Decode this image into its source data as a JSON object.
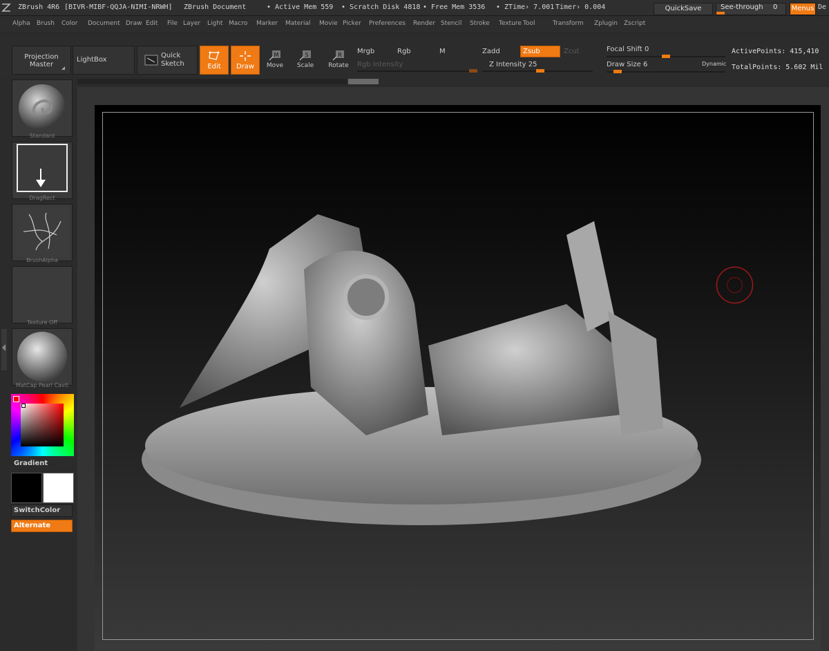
{
  "titlebar": {
    "app": "ZBrush 4R6",
    "serial": "[BIVR-MIBF-QQJA-NIMI-NRWH]",
    "document": "ZBrush Document",
    "active_mem": "• Active Mem 559",
    "scratch_disk": "• Scratch Disk 4818",
    "free_mem": "• Free Mem 3536",
    "ztime": "• ZTime› 7.001",
    "timer": "Timer› 0.004",
    "quicksave": "QuickSave",
    "see_through_label": "See-through",
    "see_through_value": "0",
    "see_through_level": 0.08,
    "menus": "Menus",
    "default_cut": "De"
  },
  "menubar": {
    "items": [
      "Alpha",
      "Brush",
      "Color",
      "Document",
      "Draw",
      "Edit",
      "File",
      "Layer",
      "Light",
      "Macro",
      "Marker",
      "Material",
      "Movie",
      "Picker",
      "Preferences",
      "Render",
      "Stencil",
      "Stroke",
      "Texture",
      "Tool",
      "Transform",
      "Zplugin",
      "Zscript"
    ]
  },
  "toolbar": {
    "projection_master_1": "Projection",
    "projection_master_2": "Master",
    "lightbox": "LightBox",
    "quick_sketch_1": "Quick",
    "quick_sketch_2": "Sketch",
    "edit": "Edit",
    "draw": "Draw",
    "move": "Move",
    "scale": "Scale",
    "rotate": "Rotate",
    "mrgb": "Mrgb",
    "rgb": "Rgb",
    "m": "M",
    "rgb_intensity": "Rgb  Intensity",
    "zadd": "Zadd",
    "zsub": "Zsub",
    "zcut": "Zcut",
    "z_intensity": "Z Intensity 25",
    "z_intensity_value": 25,
    "focal_shift": "Focal Shift 0",
    "focal_shift_value": 0,
    "draw_size": "Draw Size 6",
    "draw_size_value": 6,
    "dynamic": "Dynamic",
    "active_points": "ActivePoints: 415,410",
    "total_points": "TotalPoints: 5.602 Mil"
  },
  "lefttray": {
    "brush": "Standard",
    "stroke": "DragRect",
    "alpha": "BrushAlpha",
    "texture": "Texture Off",
    "material": "MatCap Pearl Cavit",
    "gradient": "Gradient",
    "switchcolor": "SwitchColor",
    "alternate": "Alternate"
  },
  "colors": {
    "accent": "#f07a14",
    "background": "#2b2b2b",
    "primary_color": "#000000",
    "secondary_color": "#ffffff"
  }
}
